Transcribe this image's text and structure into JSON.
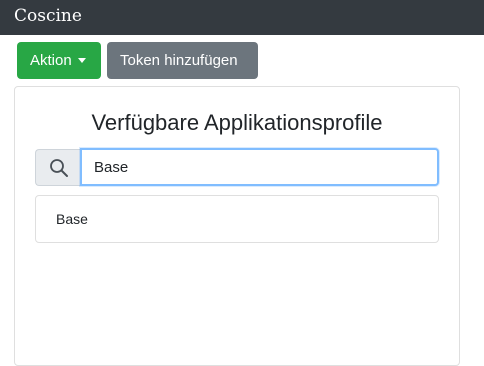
{
  "app": {
    "logo_text": "Coscine"
  },
  "toolbar": {
    "action_label": "Aktion",
    "add_token_label": "Token hinzufügen"
  },
  "panel": {
    "title": "Verfügbare Applikationsprofile",
    "search": {
      "value": "Base",
      "placeholder": ""
    },
    "results": [
      {
        "label": "Base"
      }
    ]
  },
  "colors": {
    "topbar": "#343a40",
    "success": "#28a745",
    "secondary": "#6c757d",
    "focus_border": "#80bdff"
  },
  "icons": {
    "search": "search-icon",
    "caret": "caret-down-icon"
  }
}
